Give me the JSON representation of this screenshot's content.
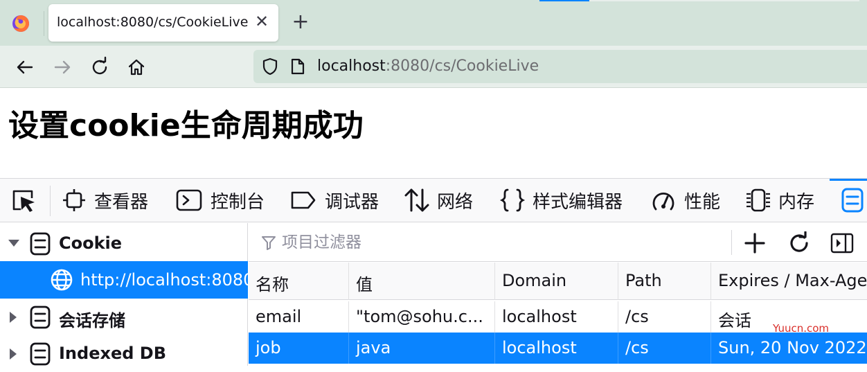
{
  "browser": {
    "tab_title": "localhost:8080/cs/CookieLive",
    "url_host": "localhost",
    "url_rest": ":8080/cs/CookieLive"
  },
  "page": {
    "heading": "设置cookie生命周期成功"
  },
  "devtools": {
    "tabs": [
      {
        "label": "查看器",
        "icon": "inspector-icon"
      },
      {
        "label": "控制台",
        "icon": "console-icon"
      },
      {
        "label": "调试器",
        "icon": "debugger-icon"
      },
      {
        "label": "网络",
        "icon": "network-icon"
      },
      {
        "label": "样式编辑器",
        "icon": "style-editor-icon"
      },
      {
        "label": "性能",
        "icon": "performance-icon"
      },
      {
        "label": "内存",
        "icon": "memory-icon"
      }
    ],
    "active_tab_icon": "storage-icon",
    "accent_color": "#0a84ff"
  },
  "storage_tree": {
    "items": [
      {
        "label": "Cookie",
        "expanded": true
      },
      {
        "label": "http://localhost:8080",
        "selected": true
      },
      {
        "label": "会话存储",
        "expanded": false
      },
      {
        "label": "Indexed DB",
        "expanded": false
      }
    ]
  },
  "filter": {
    "placeholder": "项目过滤器"
  },
  "table": {
    "columns": [
      "名称",
      "值",
      "Domain",
      "Path",
      "Expires / Max-Age"
    ],
    "rows": [
      [
        "email",
        "\"tom@sohu.c...",
        "localhost",
        "/cs",
        "会话"
      ],
      [
        "job",
        "java",
        "localhost",
        "/cs",
        "Sun, 20 Nov 2022"
      ]
    ],
    "selected_row": 1
  },
  "watermark": "Yuucn.com"
}
